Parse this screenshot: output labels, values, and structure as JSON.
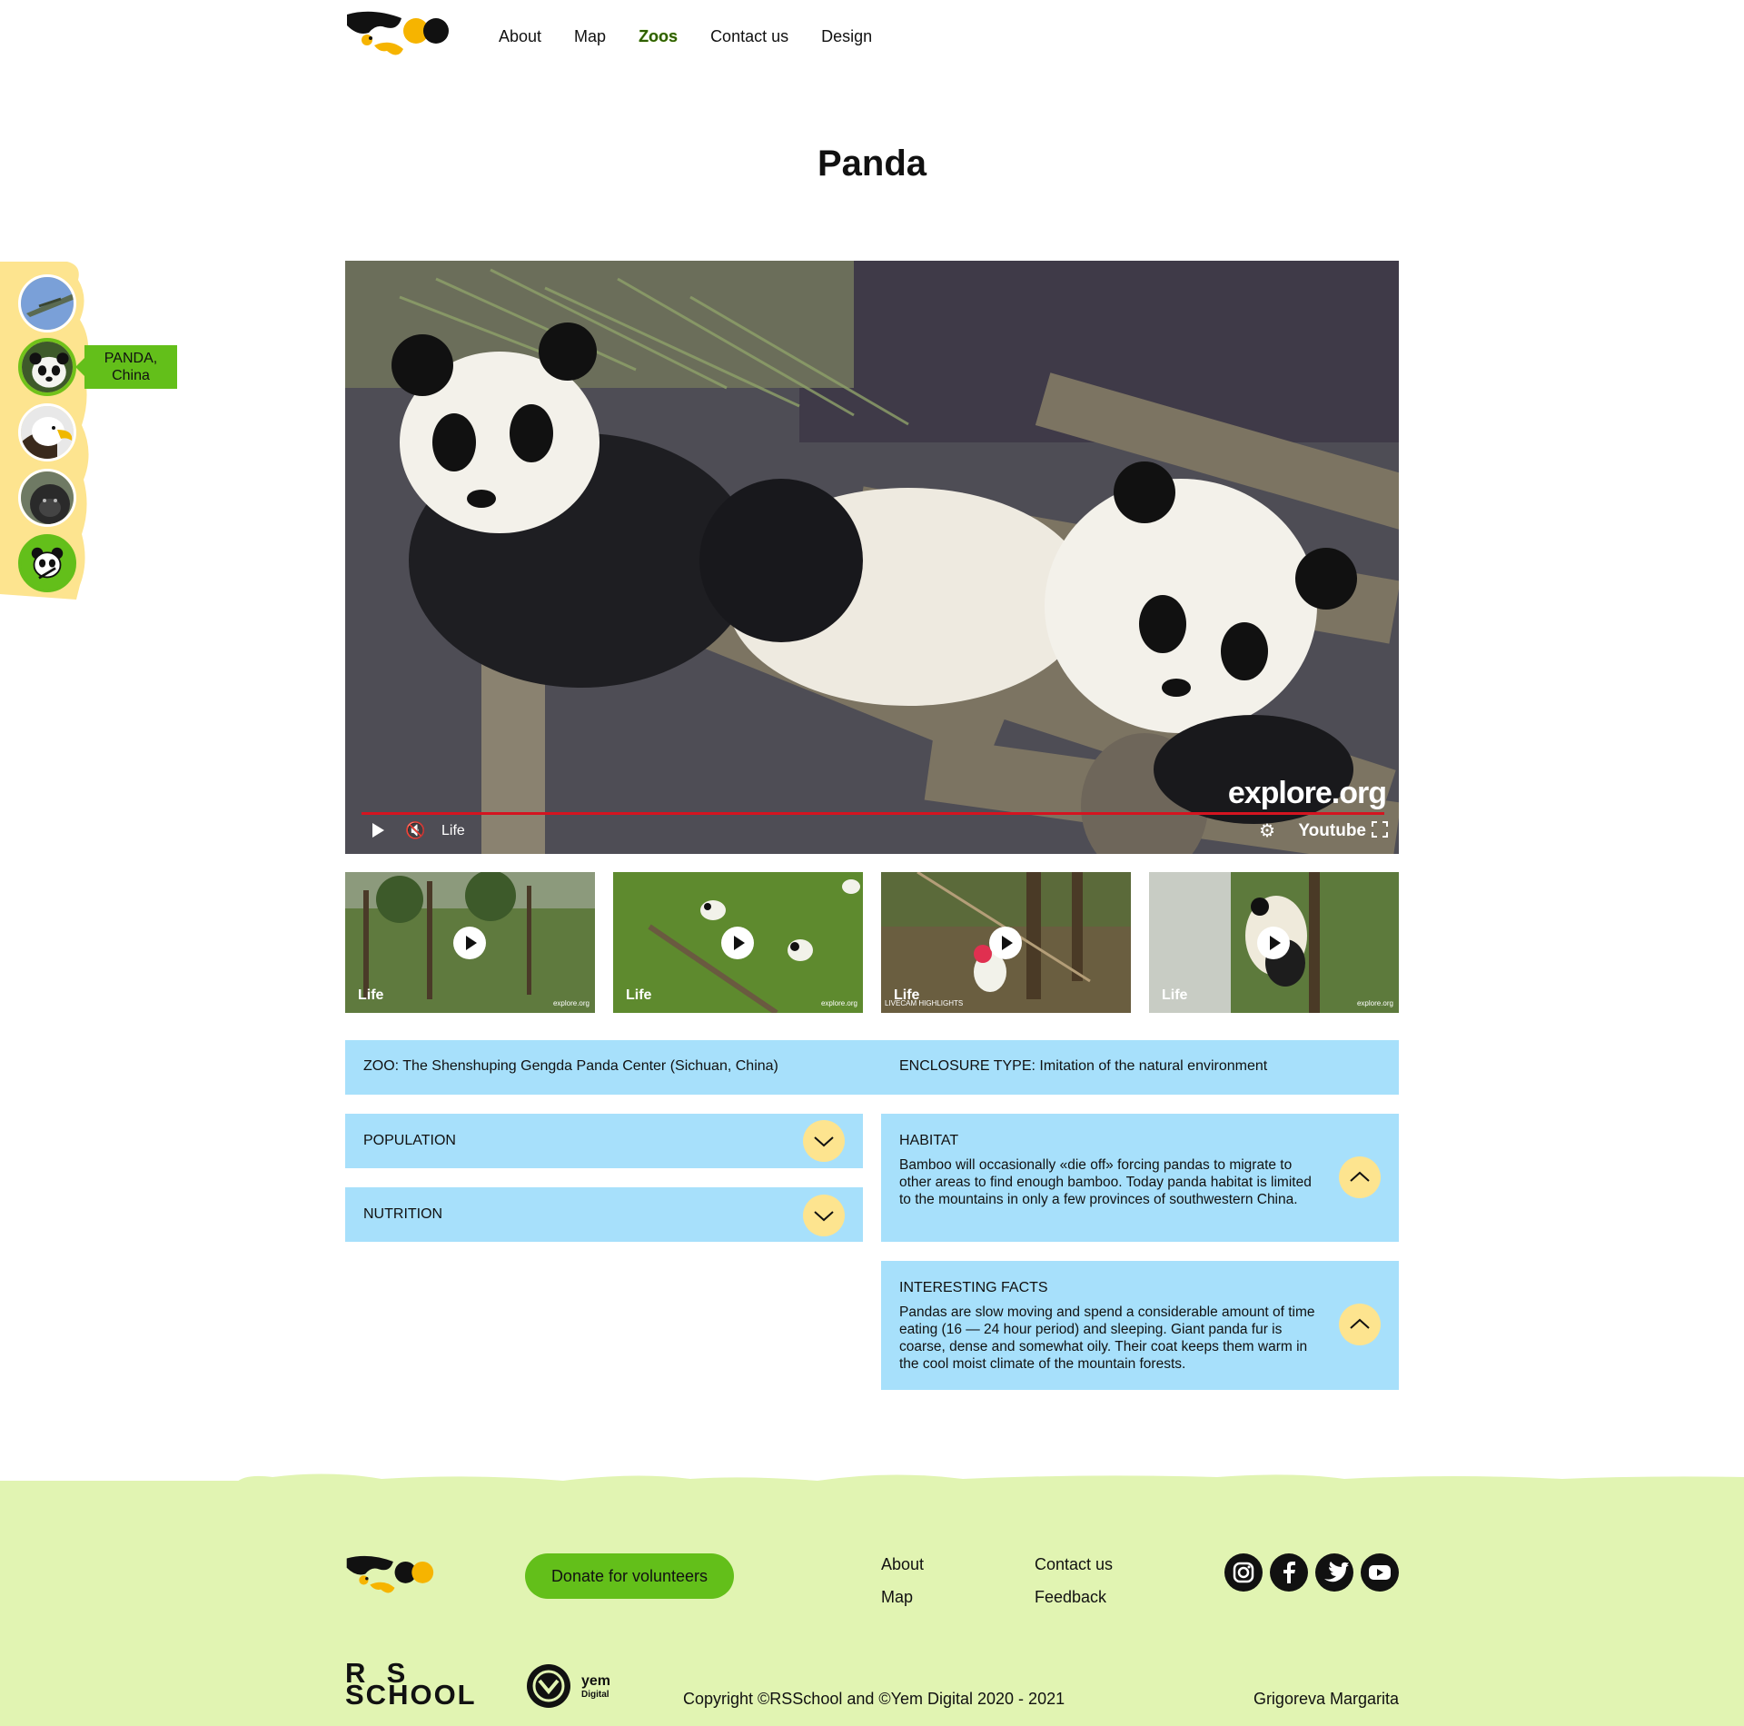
{
  "nav": {
    "items": [
      {
        "label": "About"
      },
      {
        "label": "Map"
      },
      {
        "label": "Zoos"
      },
      {
        "label": "Contact us"
      },
      {
        "label": "Design"
      }
    ],
    "active": "Zoos"
  },
  "page": {
    "title": "Panda"
  },
  "sidebar": {
    "items": [
      {
        "icon": "alligator-avatar"
      },
      {
        "icon": "panda-avatar",
        "active": true
      },
      {
        "icon": "eagle-avatar"
      },
      {
        "icon": "gorilla-avatar"
      },
      {
        "icon": "panda-cartoon-icon"
      }
    ],
    "tooltip_line1": "PANDA,",
    "tooltip_line2": "China"
  },
  "video": {
    "live_label": "Life",
    "brand": "explore.org",
    "platform": "Youtube"
  },
  "thumbnails": [
    {
      "label": "Life",
      "brand": "explore.org"
    },
    {
      "label": "Life",
      "brand": "explore.org"
    },
    {
      "label": "Life",
      "brand": "LIVECAM HIGHLIGHTS"
    },
    {
      "label": "Life",
      "brand": "explore.org"
    }
  ],
  "info": {
    "zoo": "ZOO: The Shenshuping Gengda Panda Center (Sichuan, China)",
    "enclosure": "ENCLOSURE TYPE: Imitation of the natural environment"
  },
  "panels": {
    "population": {
      "title": "POPULATION",
      "expanded": false
    },
    "nutrition": {
      "title": "NUTRITION",
      "expanded": false
    },
    "habitat": {
      "title": "HABITAT",
      "expanded": true,
      "text": "Bamboo will occasionally «die off» forcing pandas to migrate to other areas to find enough bamboo. Today panda habitat is limited to the mountains in only a few provinces of southwestern China."
    },
    "facts": {
      "title": "INTERESTING FACTS",
      "expanded": true,
      "text": "Pandas are slow moving and spend a considerable amount of time eating (16 — 24 hour period) and sleeping. Giant panda fur is coarse, dense and somewhat oily. Their coat keeps them warm in the cool moist climate of the mountain forests."
    }
  },
  "footer": {
    "donate_label": "Donate for volunteers",
    "links": {
      "about": "About",
      "map": "Map",
      "contact": "Contact us",
      "feedback": "Feedback"
    },
    "social": [
      "instagram-icon",
      "facebook-icon",
      "twitter-icon",
      "youtube-icon"
    ],
    "rs_line1": "R  S",
    "rs_line2": "SCHOOL",
    "yem_line1": "yem",
    "yem_line2": "Digital",
    "copyright": "Copyright ©RSSchool and ©Yem Digital 2020 - 2021",
    "author": "Grigoreva Margarita"
  },
  "colors": {
    "accent_green": "#63bf1a",
    "panel_blue": "#a7e0fb",
    "chevron_yellow": "#fde48f",
    "footer_bg": "#e1f4b2",
    "logo_yellow": "#f6b400"
  }
}
